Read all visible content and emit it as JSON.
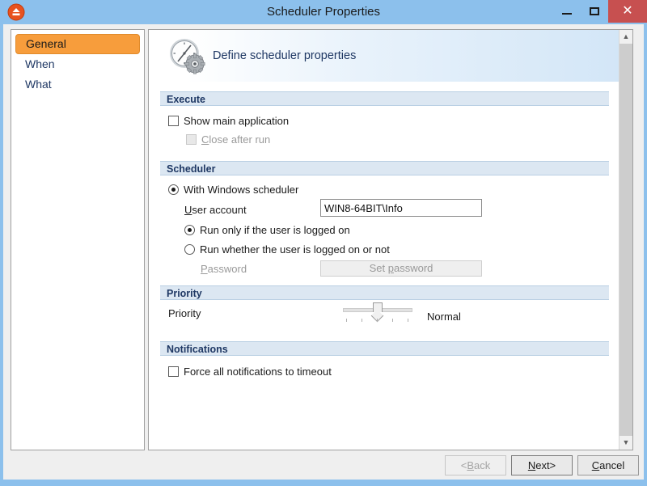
{
  "window": {
    "title": "Scheduler Properties",
    "app_icon": "eject-circle-icon",
    "controls": {
      "minimize": "–",
      "maximize": "□",
      "close": "✕"
    },
    "frame_color": "#8cc0ec",
    "close_color": "#c75050"
  },
  "sidebar": {
    "items": [
      {
        "label": "General",
        "selected": true
      },
      {
        "label": "When",
        "selected": false
      },
      {
        "label": "What",
        "selected": false
      }
    ],
    "selected_color": "#f79d3c"
  },
  "banner": {
    "icon": "clock-gear-icon",
    "text": "Define scheduler properties"
  },
  "sections": {
    "execute": {
      "title": "Execute",
      "show_main_application": {
        "label": "Show main application",
        "checked": false,
        "enabled": true
      },
      "close_after_run": {
        "label_pre": "",
        "accel": "C",
        "label_post": "lose after run",
        "checked": false,
        "enabled": false
      }
    },
    "scheduler": {
      "title": "Scheduler",
      "with_windows_scheduler": {
        "label": "With Windows scheduler",
        "selected": true
      },
      "user_account": {
        "label_accel": "U",
        "label_post": "ser account",
        "value": "WIN8-64BIT\\Info",
        "placeholder": ""
      },
      "run_only_if_logged_on": {
        "label": "Run only if the user is logged on",
        "selected": true
      },
      "run_whether_logged_on": {
        "label": "Run whether the user is logged on or not",
        "selected": false
      },
      "password": {
        "label_accel": "P",
        "label_post": "assword",
        "enabled": false
      },
      "set_password_button": {
        "label_pre": "Set ",
        "accel": "p",
        "label_post": "assword",
        "enabled": false
      }
    },
    "priority": {
      "title": "Priority",
      "label": "Priority",
      "value_text": "Normal",
      "slider": {
        "min": 0,
        "max": 4,
        "value": 2,
        "tick_count": 5
      }
    },
    "notifications": {
      "title": "Notifications",
      "force_timeout": {
        "label": "Force all notifications to timeout",
        "checked": false,
        "enabled": true
      }
    }
  },
  "scrollbar": {
    "up_arrow": "▲",
    "down_arrow": "▼"
  },
  "footer": {
    "back": {
      "label_pre": "<",
      "accel": "B",
      "label_post": "ack",
      "enabled": false
    },
    "next": {
      "label_pre": "",
      "accel": "N",
      "label_post": "ext>",
      "enabled": true,
      "default": true
    },
    "cancel": {
      "label_pre": "",
      "accel": "C",
      "label_post": "ancel",
      "enabled": true
    }
  }
}
